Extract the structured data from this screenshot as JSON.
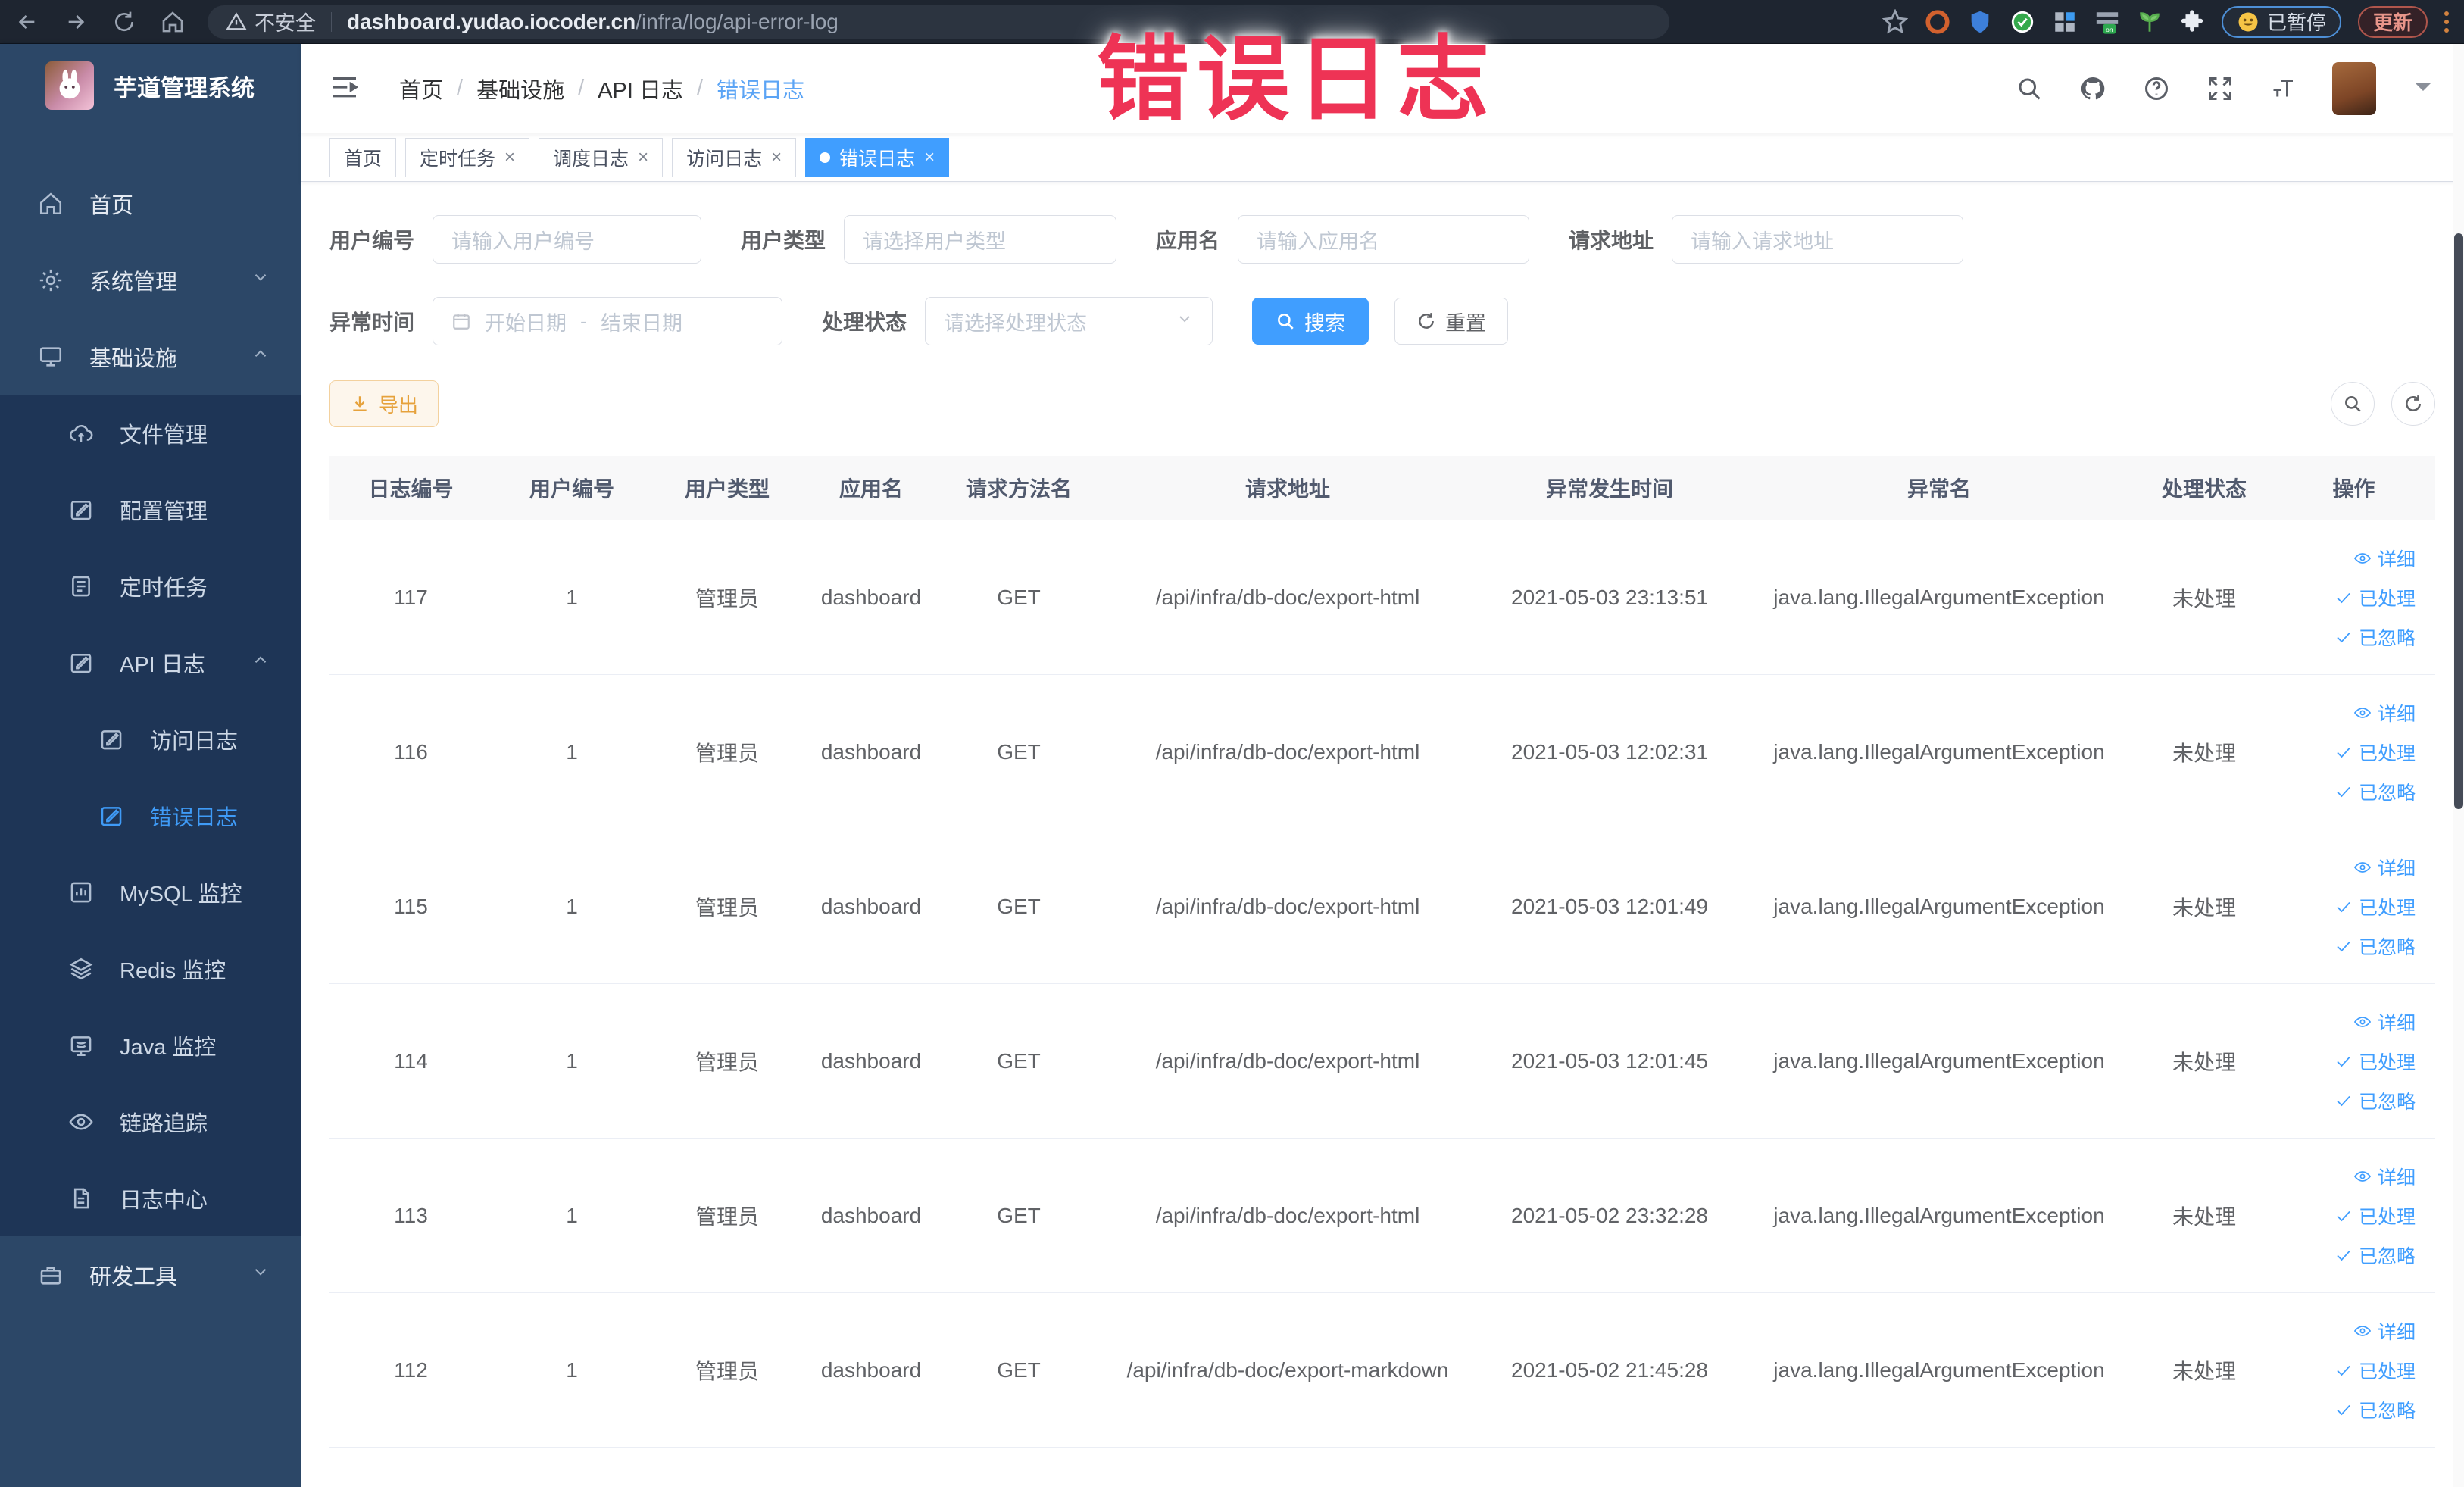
{
  "browser": {
    "security_label": "不安全",
    "url_domain": "dashboard.yudao.iocoder.cn",
    "url_path": "/infra/log/api-error-log",
    "paused_badge": "已暂停",
    "update_button": "更新"
  },
  "watermark": {
    "text": "错误日志",
    "color": "#ee3355"
  },
  "sidebar": {
    "title": "芋道管理系统",
    "menu": [
      {
        "label": "首页",
        "icon": "home-icon",
        "level": 0,
        "zone": "base"
      },
      {
        "label": "系统管理",
        "icon": "gear-icon",
        "level": 0,
        "zone": "base",
        "chevron": "down"
      },
      {
        "label": "基础设施",
        "icon": "monitor-icon",
        "level": 0,
        "zone": "base",
        "chevron": "up"
      },
      {
        "label": "文件管理",
        "icon": "cloud-upload-icon",
        "level": 1,
        "zone": "dark"
      },
      {
        "label": "配置管理",
        "icon": "edit-icon",
        "level": 1,
        "zone": "dark"
      },
      {
        "label": "定时任务",
        "icon": "clipboard-icon",
        "level": 1,
        "zone": "dark"
      },
      {
        "label": "API 日志",
        "icon": "edit-icon",
        "level": 1,
        "zone": "dark",
        "chevron": "up"
      },
      {
        "label": "访问日志",
        "icon": "edit-icon",
        "level": 2,
        "zone": "dark"
      },
      {
        "label": "错误日志",
        "icon": "edit-icon",
        "level": 2,
        "zone": "dark",
        "active": true
      },
      {
        "label": "MySQL 监控",
        "icon": "chart-icon",
        "level": 1,
        "zone": "dark"
      },
      {
        "label": "Redis 监控",
        "icon": "layers-icon",
        "level": 1,
        "zone": "dark"
      },
      {
        "label": "Java 监控",
        "icon": "java-icon",
        "level": 1,
        "zone": "dark"
      },
      {
        "label": "链路追踪",
        "icon": "eye-icon",
        "level": 1,
        "zone": "dark"
      },
      {
        "label": "日志中心",
        "icon": "document-icon",
        "level": 1,
        "zone": "dark"
      },
      {
        "label": "研发工具",
        "icon": "toolbox-icon",
        "level": 0,
        "zone": "base",
        "chevron": "down"
      }
    ]
  },
  "header": {
    "breadcrumb": [
      "首页",
      "基础设施",
      "API 日志",
      "错误日志"
    ]
  },
  "tabs": [
    {
      "label": "首页",
      "closable": false,
      "active": false
    },
    {
      "label": "定时任务",
      "closable": true,
      "active": false
    },
    {
      "label": "调度日志",
      "closable": true,
      "active": false
    },
    {
      "label": "访问日志",
      "closable": true,
      "active": false
    },
    {
      "label": "错误日志",
      "closable": true,
      "active": true
    }
  ],
  "filters": {
    "row1": [
      {
        "label": "用户编号",
        "placeholder": "请输入用户编号",
        "type": "input",
        "w": "w-input1"
      },
      {
        "label": "用户类型",
        "placeholder": "请选择用户类型",
        "type": "select",
        "w": "w-select1"
      },
      {
        "label": "应用名",
        "placeholder": "请输入应用名",
        "type": "input",
        "w": "w-input2"
      },
      {
        "label": "请求地址",
        "placeholder": "请输入请求地址",
        "type": "input",
        "w": "w-input3"
      }
    ],
    "time_label": "异常时间",
    "date_start_placeholder": "开始日期",
    "date_separator": "-",
    "date_end_placeholder": "结束日期",
    "status_label": "处理状态",
    "status_placeholder": "请选择处理状态",
    "search_button": "搜索",
    "reset_button": "重置"
  },
  "toolbar": {
    "export_button": "导出"
  },
  "table": {
    "columns": [
      "日志编号",
      "用户编号",
      "用户类型",
      "应用名",
      "请求方法名",
      "请求地址",
      "异常发生时间",
      "异常名",
      "处理状态",
      "操作"
    ],
    "action_labels": [
      "详细",
      "已处理",
      "已忽略"
    ],
    "rows": [
      {
        "id": "117",
        "user_id": "1",
        "user_type": "管理员",
        "app": "dashboard",
        "method": "GET",
        "url": "/api/infra/db-doc/export-html",
        "time": "2021-05-03 23:13:51",
        "exception": "java.lang.IllegalArgumentException",
        "status": "未处理"
      },
      {
        "id": "116",
        "user_id": "1",
        "user_type": "管理员",
        "app": "dashboard",
        "method": "GET",
        "url": "/api/infra/db-doc/export-html",
        "time": "2021-05-03 12:02:31",
        "exception": "java.lang.IllegalArgumentException",
        "status": "未处理"
      },
      {
        "id": "115",
        "user_id": "1",
        "user_type": "管理员",
        "app": "dashboard",
        "method": "GET",
        "url": "/api/infra/db-doc/export-html",
        "time": "2021-05-03 12:01:49",
        "exception": "java.lang.IllegalArgumentException",
        "status": "未处理"
      },
      {
        "id": "114",
        "user_id": "1",
        "user_type": "管理员",
        "app": "dashboard",
        "method": "GET",
        "url": "/api/infra/db-doc/export-html",
        "time": "2021-05-03 12:01:45",
        "exception": "java.lang.IllegalArgumentException",
        "status": "未处理"
      },
      {
        "id": "113",
        "user_id": "1",
        "user_type": "管理员",
        "app": "dashboard",
        "method": "GET",
        "url": "/api/infra/db-doc/export-html",
        "time": "2021-05-02 23:32:28",
        "exception": "java.lang.IllegalArgumentException",
        "status": "未处理"
      },
      {
        "id": "112",
        "user_id": "1",
        "user_type": "管理员",
        "app": "dashboard",
        "method": "GET",
        "url": "/api/infra/db-doc/export-markdown",
        "time": "2021-05-02 21:45:28",
        "exception": "java.lang.IllegalArgumentException",
        "status": "未处理"
      }
    ]
  }
}
